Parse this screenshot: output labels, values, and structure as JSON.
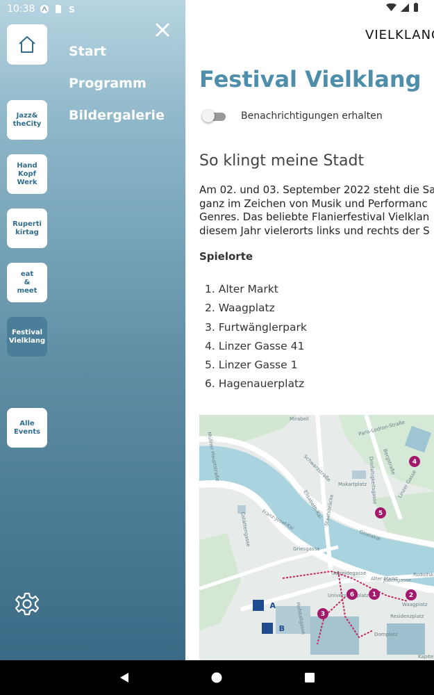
{
  "status_bar": {
    "time": "10:38"
  },
  "drawer": {
    "tiles": [
      {
        "name": "home",
        "label": ""
      },
      {
        "name": "jazz-the-city",
        "label": "Jazz&\ntheCity"
      },
      {
        "name": "hand-kopf-werk",
        "label": "Hand\nKopf\nWerk"
      },
      {
        "name": "rupertikirtag",
        "label": "Ruperti\nkirtag"
      },
      {
        "name": "eat-meet",
        "label": "eat\n&\nmeet"
      },
      {
        "name": "festival-vielklang",
        "label": "Festival\nVielklang",
        "active": true
      },
      {
        "name": "alle-events",
        "label": "Alle\nEvents"
      }
    ],
    "nav": [
      "Start",
      "Programm",
      "Bildergalerie"
    ]
  },
  "main": {
    "logo": "VIELKLANG",
    "title": "Festival Vielklang",
    "toggle_label": "Benachrichtigungen erhalten",
    "toggle_on": false,
    "subtitle": "So klingt meine Stadt",
    "paragraph_lines": [
      "Am 02. und 03. September 2022 steht die Sa",
      "ganz im Zeichen von Musik und Performanc",
      "Genres. Das beliebte Flanierfestival Vielklan",
      "diesem Jahr vielerorts links und rechts der S"
    ],
    "venues_heading": "Spielorte",
    "venues": [
      "Alter Markt",
      "Waagplatz",
      "Furtwänglerpark",
      "Linzer Gasse 41",
      "Linzer Gasse 1",
      "Hagenauerplatz"
    ]
  },
  "map": {
    "streets": [
      "Mirabell",
      "Paris-Lodron-Straße",
      "Schwarzstraße",
      "Makartplatz",
      "Müllner Hauptstraße",
      "Dreifaltigkeitsgasse",
      "Bergstraße",
      "Linzer Gasse",
      "Franz-Josef-Kai",
      "Gstättengasse",
      "Elisabeth-Kai",
      "Staatsbrücke",
      "Giselakai",
      "Griesgasse",
      "Getreidegasse",
      "Judengasse",
      "Rudolfskai",
      "Alter Markt",
      "Waagplatz",
      "Residenzplatz",
      "Hofstallgasse",
      "Domplatz",
      "Universitätsplatz",
      "Kapitelplatz"
    ],
    "markers": [
      "1",
      "2",
      "3",
      "4",
      "5",
      "6"
    ],
    "parking": [
      "P A",
      "P B"
    ]
  },
  "colors": {
    "accent": "#4e8eaa",
    "marker": "#a3196b",
    "route": "#c0285e"
  }
}
